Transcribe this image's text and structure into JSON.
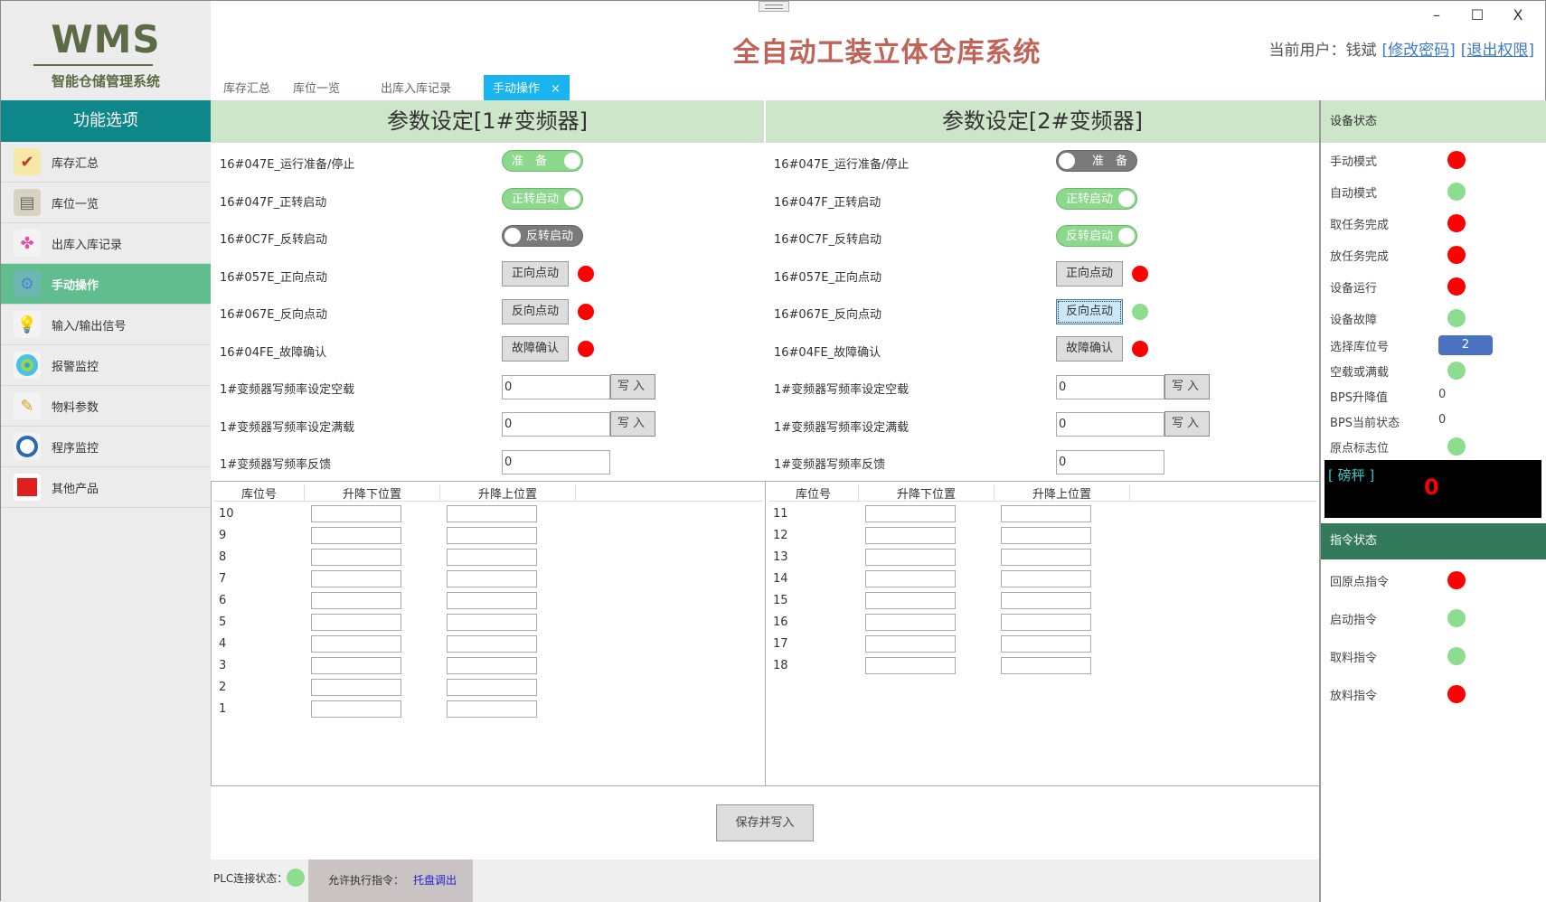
{
  "logo": {
    "title": "WMS",
    "subtitle": "智能仓储管理系统"
  },
  "app_title": "全自动工装立体仓库系统",
  "user": {
    "label": "当前用户：钱斌",
    "change_password": "[修改密码]",
    "logout": "[退出权限]"
  },
  "window": {
    "minimize": "–",
    "maximize": "☐",
    "close": "X"
  },
  "tabs": [
    {
      "label": "库存汇总"
    },
    {
      "label": "库位一览"
    },
    {
      "label": "出库入库记录"
    },
    {
      "label": "手动操作",
      "close": "×",
      "active": true
    }
  ],
  "sidebar": {
    "header": "功能选项",
    "items": [
      {
        "label": "库存汇总",
        "icon": "checklist-icon"
      },
      {
        "label": "库位一览",
        "icon": "document-icon"
      },
      {
        "label": "出库入库记录",
        "icon": "clover-icon"
      },
      {
        "label": "手动操作",
        "icon": "gear-icon",
        "active": true
      },
      {
        "label": "输入/输出信号",
        "icon": "lightbulb-icon"
      },
      {
        "label": "报警监控",
        "icon": "alarm-icon"
      },
      {
        "label": "物料参数",
        "icon": "pencil-icon"
      },
      {
        "label": "程序监控",
        "icon": "clock-icon"
      },
      {
        "label": "其他产品",
        "icon": "red-book-icon"
      }
    ]
  },
  "vfd1": {
    "title": "参数设定[1#变频器]",
    "rows": [
      {
        "label": "16#047E_运行准备/停止",
        "type": "toggle",
        "text": "准　备",
        "on": true
      },
      {
        "label": "16#047F_正转启动",
        "type": "toggle",
        "text": "正转启动",
        "on": true
      },
      {
        "label": "16#0C7F_反转启动",
        "type": "toggle",
        "text": "反转启动",
        "on": false
      },
      {
        "label": "16#057E_正向点动",
        "type": "button",
        "text": "正向点动",
        "led": "red"
      },
      {
        "label": "16#067E_反向点动",
        "type": "button",
        "text": "反向点动",
        "led": "red"
      },
      {
        "label": "16#04FE_故障确认",
        "type": "button",
        "text": "故障确认",
        "led": "red"
      },
      {
        "label": "1#变频器写频率设定空载",
        "type": "input",
        "value": "0",
        "button": "写入"
      },
      {
        "label": "1#变频器写频率设定满载",
        "type": "input",
        "value": "0",
        "button": "写入"
      },
      {
        "label": "1#变频器写频率反馈",
        "type": "input",
        "value": "0"
      }
    ],
    "grid": {
      "headers": [
        "库位号",
        "升降下位置",
        "升降上位置"
      ],
      "rows": [
        "10",
        "9",
        "8",
        "7",
        "6",
        "5",
        "4",
        "3",
        "2",
        "1"
      ]
    }
  },
  "vfd2": {
    "title": "参数设定[2#变频器]",
    "rows": [
      {
        "label": "16#047E_运行准备/停止",
        "type": "toggle",
        "text": "准　备",
        "on": false
      },
      {
        "label": "16#047F_正转启动",
        "type": "toggle",
        "text": "正转启动",
        "on": true
      },
      {
        "label": "16#0C7F_反转启动",
        "type": "toggle",
        "text": "反转启动",
        "on": true
      },
      {
        "label": "16#057E_正向点动",
        "type": "button",
        "text": "正向点动",
        "led": "red"
      },
      {
        "label": "16#067E_反向点动",
        "type": "button",
        "text": "反向点动",
        "led": "green",
        "focused": true
      },
      {
        "label": "16#04FE_故障确认",
        "type": "button",
        "text": "故障确认",
        "led": "red"
      },
      {
        "label": "1#变频器写频率设定空载",
        "type": "input",
        "value": "0",
        "button": "写入"
      },
      {
        "label": "1#变频器写频率设定满载",
        "type": "input",
        "value": "0",
        "button": "写入"
      },
      {
        "label": "1#变频器写频率反馈",
        "type": "input",
        "value": "0"
      }
    ],
    "grid": {
      "headers": [
        "库位号",
        "升降下位置",
        "升降上位置"
      ],
      "rows": [
        "11",
        "12",
        "13",
        "14",
        "15",
        "16",
        "17",
        "18"
      ]
    }
  },
  "device_status": {
    "header": "设备状态",
    "items": [
      {
        "label": "手动模式",
        "led": "red"
      },
      {
        "label": "自动模式",
        "led": "green"
      },
      {
        "label": "取任务完成",
        "led": "red"
      },
      {
        "label": "放任务完成",
        "led": "red"
      },
      {
        "label": "设备运行",
        "led": "red"
      },
      {
        "label": "设备故障",
        "led": "green"
      }
    ],
    "select_location": {
      "label": "选择库位号",
      "value": "2"
    },
    "load": {
      "label": "空载或满载",
      "led": "green"
    },
    "bps_value": {
      "label": "BPS升降值",
      "value": "0"
    },
    "bps_state": {
      "label": "BPS当前状态",
      "value": "0"
    },
    "origin_flag": {
      "label": "原点标志位",
      "led": "green"
    },
    "scale": {
      "label": "[ 磅秤 ]",
      "value": "0"
    }
  },
  "command_status": {
    "header": "指令状态",
    "items": [
      {
        "label": "回原点指令",
        "led": "red"
      },
      {
        "label": "启动指令",
        "led": "green"
      },
      {
        "label": "取料指令",
        "led": "green"
      },
      {
        "label": "放料指令",
        "led": "red"
      }
    ]
  },
  "save_button": "保存并写入",
  "statusbar": {
    "plc_label": "PLC连接状态：",
    "plc_led": "green",
    "allow_label": "允许执行指令：",
    "allow_value": "托盘调出"
  },
  "colors": {
    "red": "#ff0000",
    "green": "#8edc8e",
    "accent": "#1ab4f0",
    "sidebar_head": "#0d878a",
    "sidebar_active": "#5fbd8e"
  }
}
